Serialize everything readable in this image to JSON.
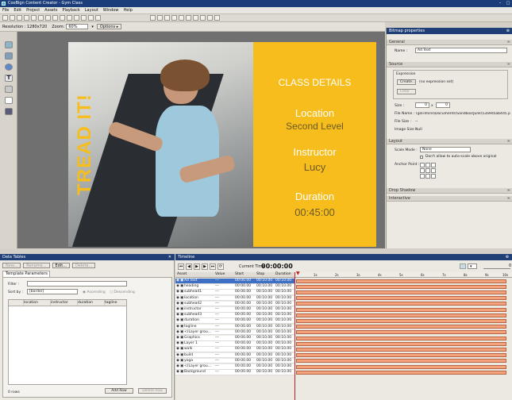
{
  "window": {
    "title": "CooBign Content Creator - Gym Class"
  },
  "menu": [
    "File",
    "Edit",
    "Project",
    "Assets",
    "Playback",
    "Layout",
    "Window",
    "Help"
  ],
  "options_bar": {
    "resolution_label": "Resolution : 1280x720",
    "zoom_label": "Zoom:",
    "zoom_value": "60%",
    "options_label": "Options ▸"
  },
  "slide": {
    "side_text": "TREAD IT!",
    "heading": "CLASS DETAILS",
    "sub1": "Location",
    "val1": "Second Level",
    "sub2": "Instructor",
    "val2": "Lucy",
    "sub3": "Duration",
    "val3": "00:45:00",
    "accent": "#f6bd1c"
  },
  "bitmap_properties": {
    "title": "Bitmap properties",
    "general": "General",
    "name_label": "Name :",
    "name_value": "Ad Text",
    "source": "Source",
    "expression": "Expression",
    "create_btn": "Create...",
    "create_note": "(no expression set)",
    "clear_btn": "Clear",
    "size_label": "Size :",
    "size_w": "0",
    "size_h": "0",
    "filename_label": "File Name :",
    "filename_value": "TgsFilmins\\Documents\\Sandbox\\Junk\\53a9d5ab4d5.pet\\Ad Text",
    "filesize_label": "File Size :",
    "filesize_value": "--",
    "imagesize_label": "Image Size :",
    "imagesize_value": "Null",
    "layout": "Layout",
    "scale_label": "Scale Mode :",
    "scale_value": "None",
    "allow_label": "Don't allow to auto-scale above original",
    "anchor_label": "Anchor Point :",
    "drop_shadow": "Drop Shadow",
    "interactive": "Interactive"
  },
  "data_tables": {
    "title": "Data Tables",
    "toolbar": [
      "New...",
      "Rename...",
      "Edit...",
      "Delete..."
    ],
    "tab": "Template Parameters",
    "filter_label": "Filter :",
    "sortby_label": "Sort by :",
    "sortby_value": "[border]",
    "ascending": "Ascending",
    "descending": "Descending",
    "columns": [
      "location",
      "instructor",
      "duration",
      "tagline"
    ],
    "rows_count": "0 rows",
    "add_row": "Add Row",
    "delete_row": "Delete Row"
  },
  "timeline": {
    "title": "Timeline",
    "current_time_label": "Current Time :",
    "current_time": "00:00:00",
    "zoom_value": "0",
    "columns": [
      "Asset",
      "Value",
      "Start",
      "Stop",
      "Duration"
    ],
    "ruler": [
      "1s",
      "2s",
      "3s",
      "4s",
      "5s",
      "6s",
      "7s",
      "8s",
      "9s",
      "10s"
    ],
    "layers": [
      {
        "name": "Ad Text",
        "value": "---",
        "start": "00:00.00",
        "stop": "00:10.00",
        "dur": "00:10.00"
      },
      {
        "name": "heading",
        "value": "---",
        "start": "00:00.00",
        "stop": "00:10.00",
        "dur": "00:10.00"
      },
      {
        "name": "subhead1",
        "value": "---",
        "start": "00:00.00",
        "stop": "00:10.00",
        "dur": "00:10.00"
      },
      {
        "name": "location",
        "value": "---",
        "start": "00:00.00",
        "stop": "00:10.00",
        "dur": "00:10.00"
      },
      {
        "name": "subhead2",
        "value": "---",
        "start": "00:00.00",
        "stop": "00:10.00",
        "dur": "00:10.00"
      },
      {
        "name": "instructor",
        "value": "---",
        "start": "00:00.00",
        "stop": "00:10.00",
        "dur": "00:10.00"
      },
      {
        "name": "subhead3",
        "value": "---",
        "start": "00:00.00",
        "stop": "00:10.00",
        "dur": "00:10.00"
      },
      {
        "name": "duration",
        "value": "---",
        "start": "00:00.00",
        "stop": "00:10.00",
        "dur": "00:10.00"
      },
      {
        "name": "tagline",
        "value": "---",
        "start": "00:00.00",
        "stop": "00:10.00",
        "dur": "00:10.00"
      },
      {
        "name": "<(Layer grou...",
        "value": "---",
        "start": "00:00.00",
        "stop": "00:10.00",
        "dur": "00:10.00"
      },
      {
        "name": "Graphics",
        "value": "---",
        "start": "00:00.00",
        "stop": "00:10.00",
        "dur": "00:10.00"
      },
      {
        "name": "Layer 1",
        "value": "---",
        "start": "00:00.00",
        "stop": "00:10.00",
        "dur": "00:10.00"
      },
      {
        "name": "walk",
        "value": "---",
        "start": "00:00.00",
        "stop": "00:10.00",
        "dur": "00:10.00"
      },
      {
        "name": "build",
        "value": "---",
        "start": "00:00.00",
        "stop": "00:10.00",
        "dur": "00:10.00"
      },
      {
        "name": "yoga",
        "value": "---",
        "start": "00:00.00",
        "stop": "00:10.00",
        "dur": "00:10.00"
      },
      {
        "name": "<(Layer grou...",
        "value": "---",
        "start": "00:00.00",
        "stop": "00:10.00",
        "dur": "00:10.00"
      },
      {
        "name": "Background",
        "value": "---",
        "start": "00:00.00",
        "stop": "00:10.00",
        "dur": "00:10.00"
      }
    ]
  }
}
